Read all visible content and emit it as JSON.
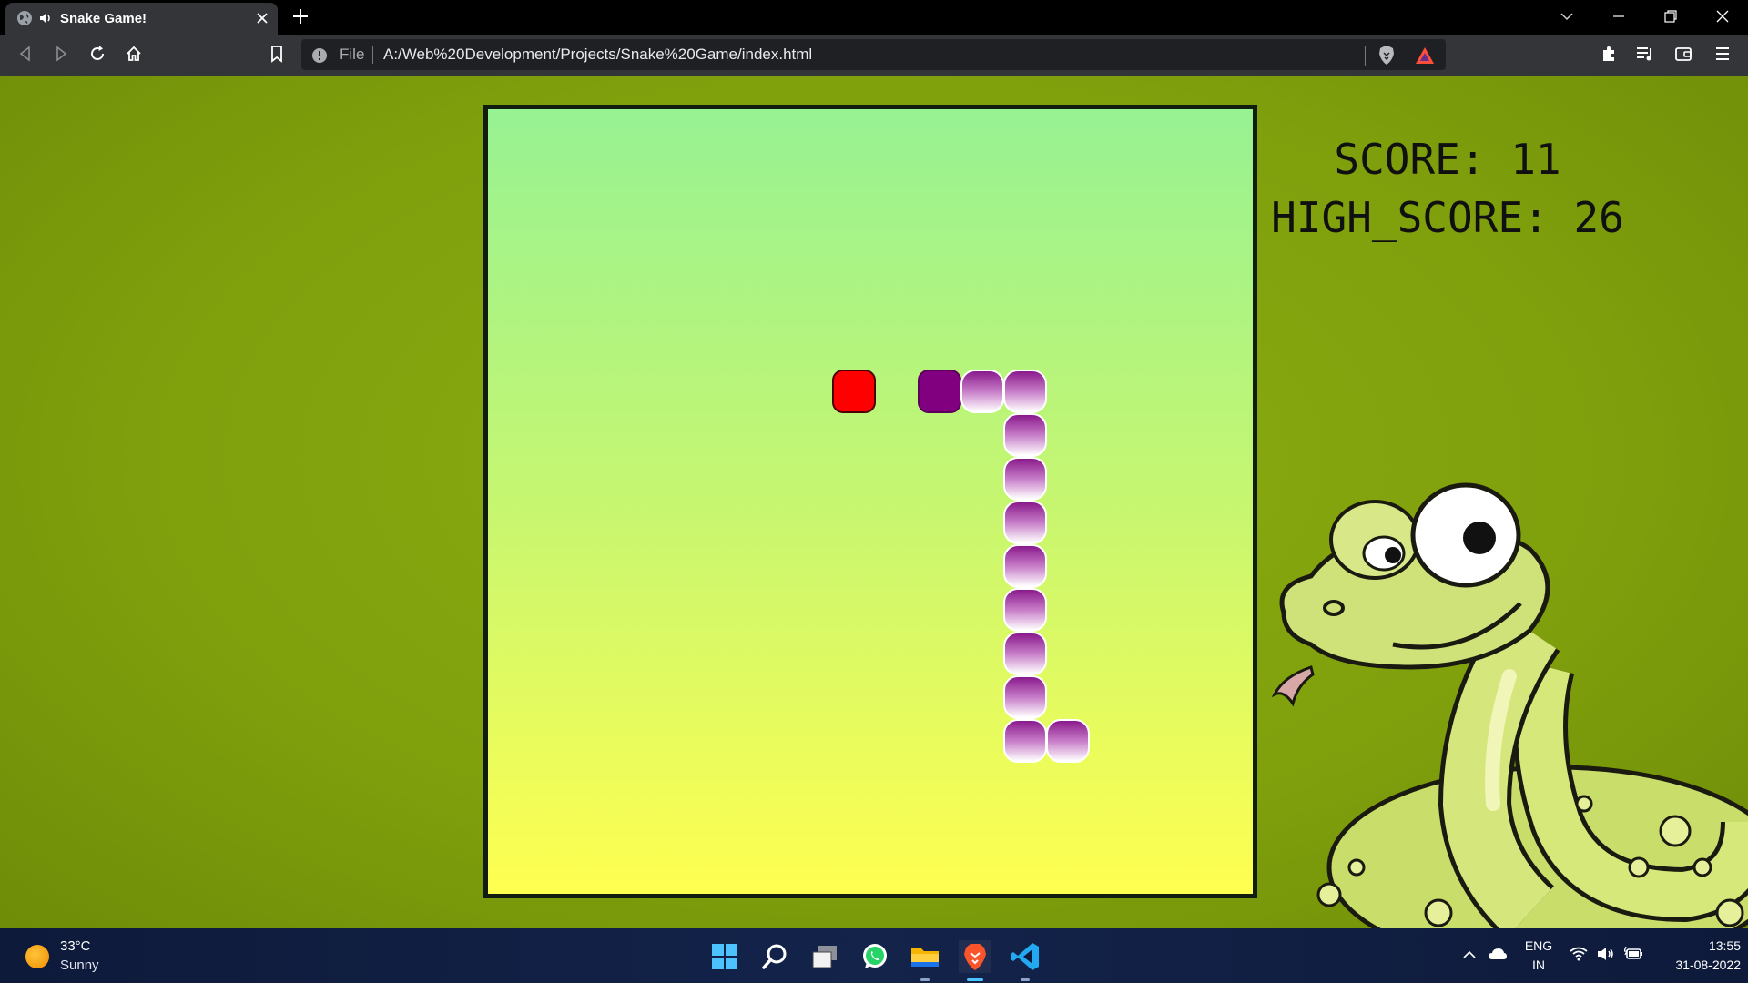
{
  "browser": {
    "tab_title": "Snake Game!",
    "new_tab_label": "+",
    "url_scheme_label": "File",
    "url": "A:/Web%20Development/Projects/Snake%20Game/index.html"
  },
  "game": {
    "score_label": "SCORE: 11",
    "high_score_label": "HIGH_SCORE: 26",
    "score": 11,
    "high_score": 26
  },
  "taskbar": {
    "temperature": "33°C",
    "weather": "Sunny",
    "language": "ENG",
    "region": "IN",
    "time": "13:55",
    "date": "31-08-2022",
    "apps": [
      "start-icon",
      "search-icon",
      "task-view-icon",
      "whatsapp-icon",
      "file-explorer-icon",
      "brave-icon",
      "vscode-icon"
    ]
  },
  "colors": {
    "page_bg": "#7f9f0c",
    "board_top": "#97f292",
    "board_bottom": "#ffff50",
    "food": "#ff0000",
    "snake_head": "#800080"
  }
}
